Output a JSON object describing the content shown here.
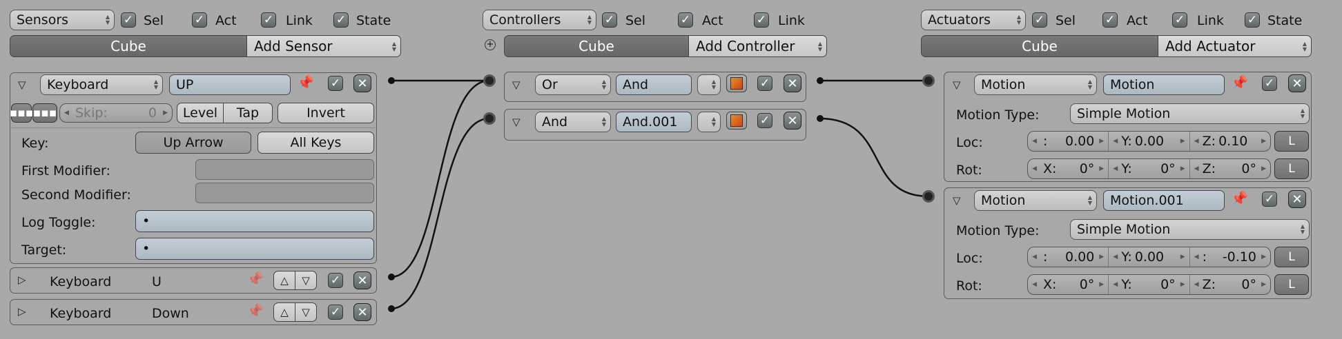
{
  "sensors": {
    "header": {
      "type_label": "Sensors",
      "sel": "Sel",
      "act": "Act",
      "link": "Link",
      "state": "State"
    },
    "object_tab": "Cube",
    "add_label": "Add Sensor",
    "s1": {
      "type": "Keyboard",
      "name": "UP",
      "skip_label": "Skip:",
      "skip_value": "0",
      "level": "Level",
      "tap": "Tap",
      "invert": "Invert",
      "key_label": "Key:",
      "key_value": "Up Arrow",
      "all_keys": "All Keys",
      "first_mod": "First Modifier:",
      "second_mod": "Second Modifier:",
      "log_toggle": "Log Toggle:",
      "log_value": "•",
      "target": "Target:",
      "target_value": "•"
    },
    "s2": {
      "type": "Keyboard",
      "name": "U"
    },
    "s3": {
      "type": "Keyboard",
      "name": "Down"
    }
  },
  "controllers": {
    "header": {
      "type_label": "Controllers",
      "sel": "Sel",
      "act": "Act",
      "link": "Link"
    },
    "object_tab": "Cube",
    "add_label": "Add Controller",
    "c1": {
      "type": "Or",
      "name": "And"
    },
    "c2": {
      "type": "And",
      "name": "And.001"
    }
  },
  "actuators": {
    "header": {
      "type_label": "Actuators",
      "sel": "Sel",
      "act": "Act",
      "link": "Link",
      "state": "State"
    },
    "object_tab": "Cube",
    "add_label": "Add Actuator",
    "a1": {
      "type": "Motion",
      "name": "Motion",
      "motion_type_label": "Motion Type:",
      "motion_type": "Simple Motion",
      "loc_label": "Loc:",
      "loc": [
        {
          "l": ":",
          "v": "0.00"
        },
        {
          "l": "Y:",
          "v": "0.00"
        },
        {
          "l": "Z:",
          "v": "0.10"
        }
      ],
      "rot_label": "Rot:",
      "rot": [
        {
          "l": "X:",
          "v": "0°"
        },
        {
          "l": "Y:",
          "v": "0°"
        },
        {
          "l": "Z:",
          "v": "0°"
        }
      ],
      "local": "L"
    },
    "a2": {
      "type": "Motion",
      "name": "Motion.001",
      "motion_type_label": "Motion Type:",
      "motion_type": "Simple Motion",
      "loc_label": "Loc:",
      "loc": [
        {
          "l": ":",
          "v": "0.00"
        },
        {
          "l": "Y:",
          "v": "0.00"
        },
        {
          "l": ":",
          "v": "-0.10"
        }
      ],
      "rot_label": "Rot:",
      "rot": [
        {
          "l": "X:",
          "v": "0°"
        },
        {
          "l": "Y:",
          "v": "0°"
        },
        {
          "l": "Z:",
          "v": "0°"
        }
      ],
      "local": "L"
    }
  },
  "icons": {
    "check": "✓",
    "close": "✕",
    "expand_open": "▽",
    "expand_closed": "▷",
    "pin": "pin-icon",
    "arrow_up": "△",
    "arrow_down": "▽"
  },
  "colors": {
    "background": "#a9a9a9",
    "panel": "#a8a8a8",
    "field": "#b8c4cc",
    "wire": "#111111"
  }
}
